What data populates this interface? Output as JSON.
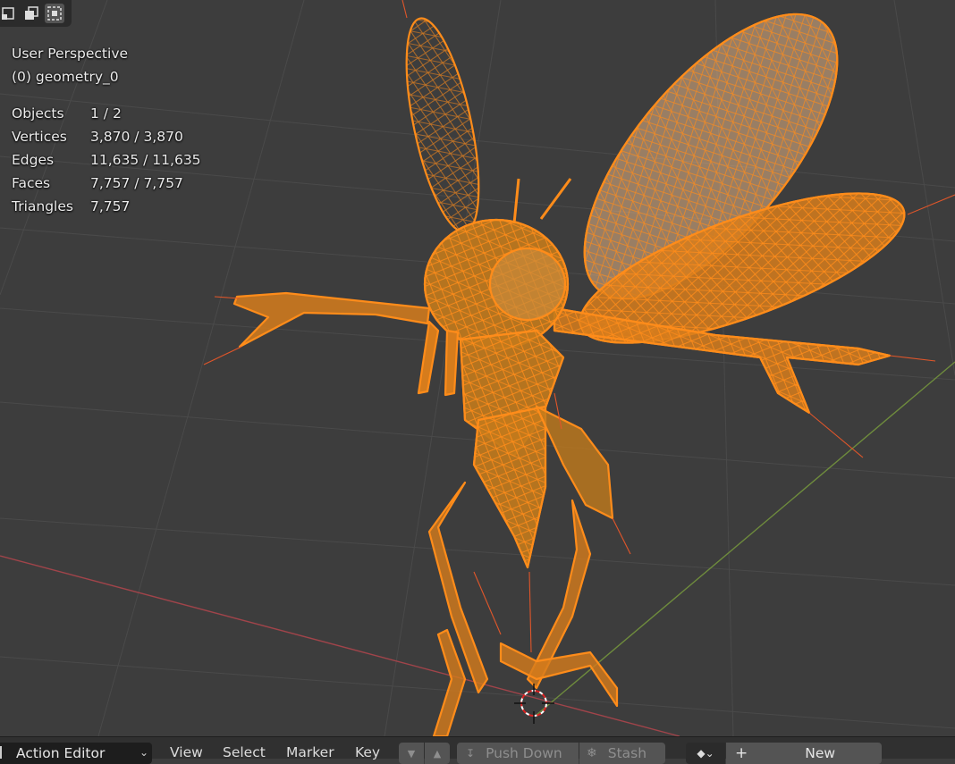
{
  "viewport": {
    "view_name": "User Perspective",
    "object_name": "(0) geometry_0",
    "stats": [
      {
        "label": "Objects",
        "value": "1 / 2"
      },
      {
        "label": "Vertices",
        "value": "3,870 / 3,870"
      },
      {
        "label": "Edges",
        "value": "11,635 / 11,635"
      },
      {
        "label": "Faces",
        "value": "7,757 / 7,757"
      },
      {
        "label": "Triangles",
        "value": "7,757"
      }
    ],
    "select_modes": [
      "vertex-select-icon",
      "edge-select-icon",
      "face-select-icon"
    ],
    "colors": {
      "background": "#3d3d3d",
      "grid": "#4a4a4a",
      "x_axis": "#a0444a",
      "y_axis": "#6e8b3d",
      "mesh": "#ff8c1a"
    }
  },
  "bottom_bar": {
    "editor_mode": "Action Editor",
    "menus": [
      "View",
      "Select",
      "Marker",
      "Key"
    ],
    "push_down_label": "Push Down",
    "stash_label": "Stash",
    "new_label": "New"
  }
}
